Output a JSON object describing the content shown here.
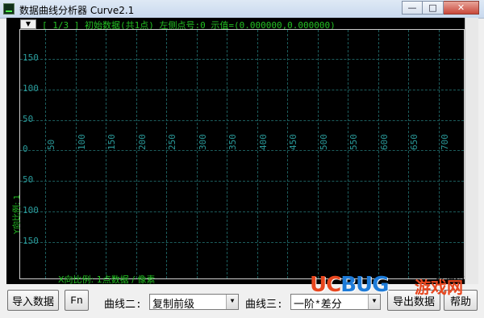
{
  "window": {
    "title": "数据曲线分析器 Curve2.1",
    "minimize_glyph": "—",
    "maximize_glyph": "□",
    "close_glyph": "✕"
  },
  "plot": {
    "dropdown_glyph": "▼",
    "info_line": "[ 1/3 ] 初始数据(共1点) 左侧点号:0 示值=(0.000000,0.000000)",
    "y_scale_label": "Y向比例: 1",
    "x_scale_label": "X向比例: 1点数据 / 像素",
    "y_ticks": [
      "150",
      "100",
      "50",
      "0",
      "50",
      "100",
      "150"
    ],
    "x_ticks": [
      "50",
      "100",
      "150",
      "200",
      "250",
      "300",
      "350",
      "400",
      "450",
      "500",
      "550",
      "600",
      "650",
      "700"
    ],
    "colors": {
      "background": "#000000",
      "grid": "#1c5c5c",
      "tick_text": "#2a9a9a",
      "info_text": "#22c022"
    }
  },
  "controls": {
    "import_button": "导入数据",
    "fn_button": "Fn",
    "curve2_label": "曲线二:",
    "curve2_value": "复制前级",
    "curve3_label": "曲线三:",
    "curve3_value": "一阶*差分",
    "export_button": "导出数据",
    "help_button": "帮助",
    "mark_label": "标记类"
  },
  "watermark": {
    "uc": "UC",
    "bug": "BUG",
    "cn": "游戏网"
  }
}
